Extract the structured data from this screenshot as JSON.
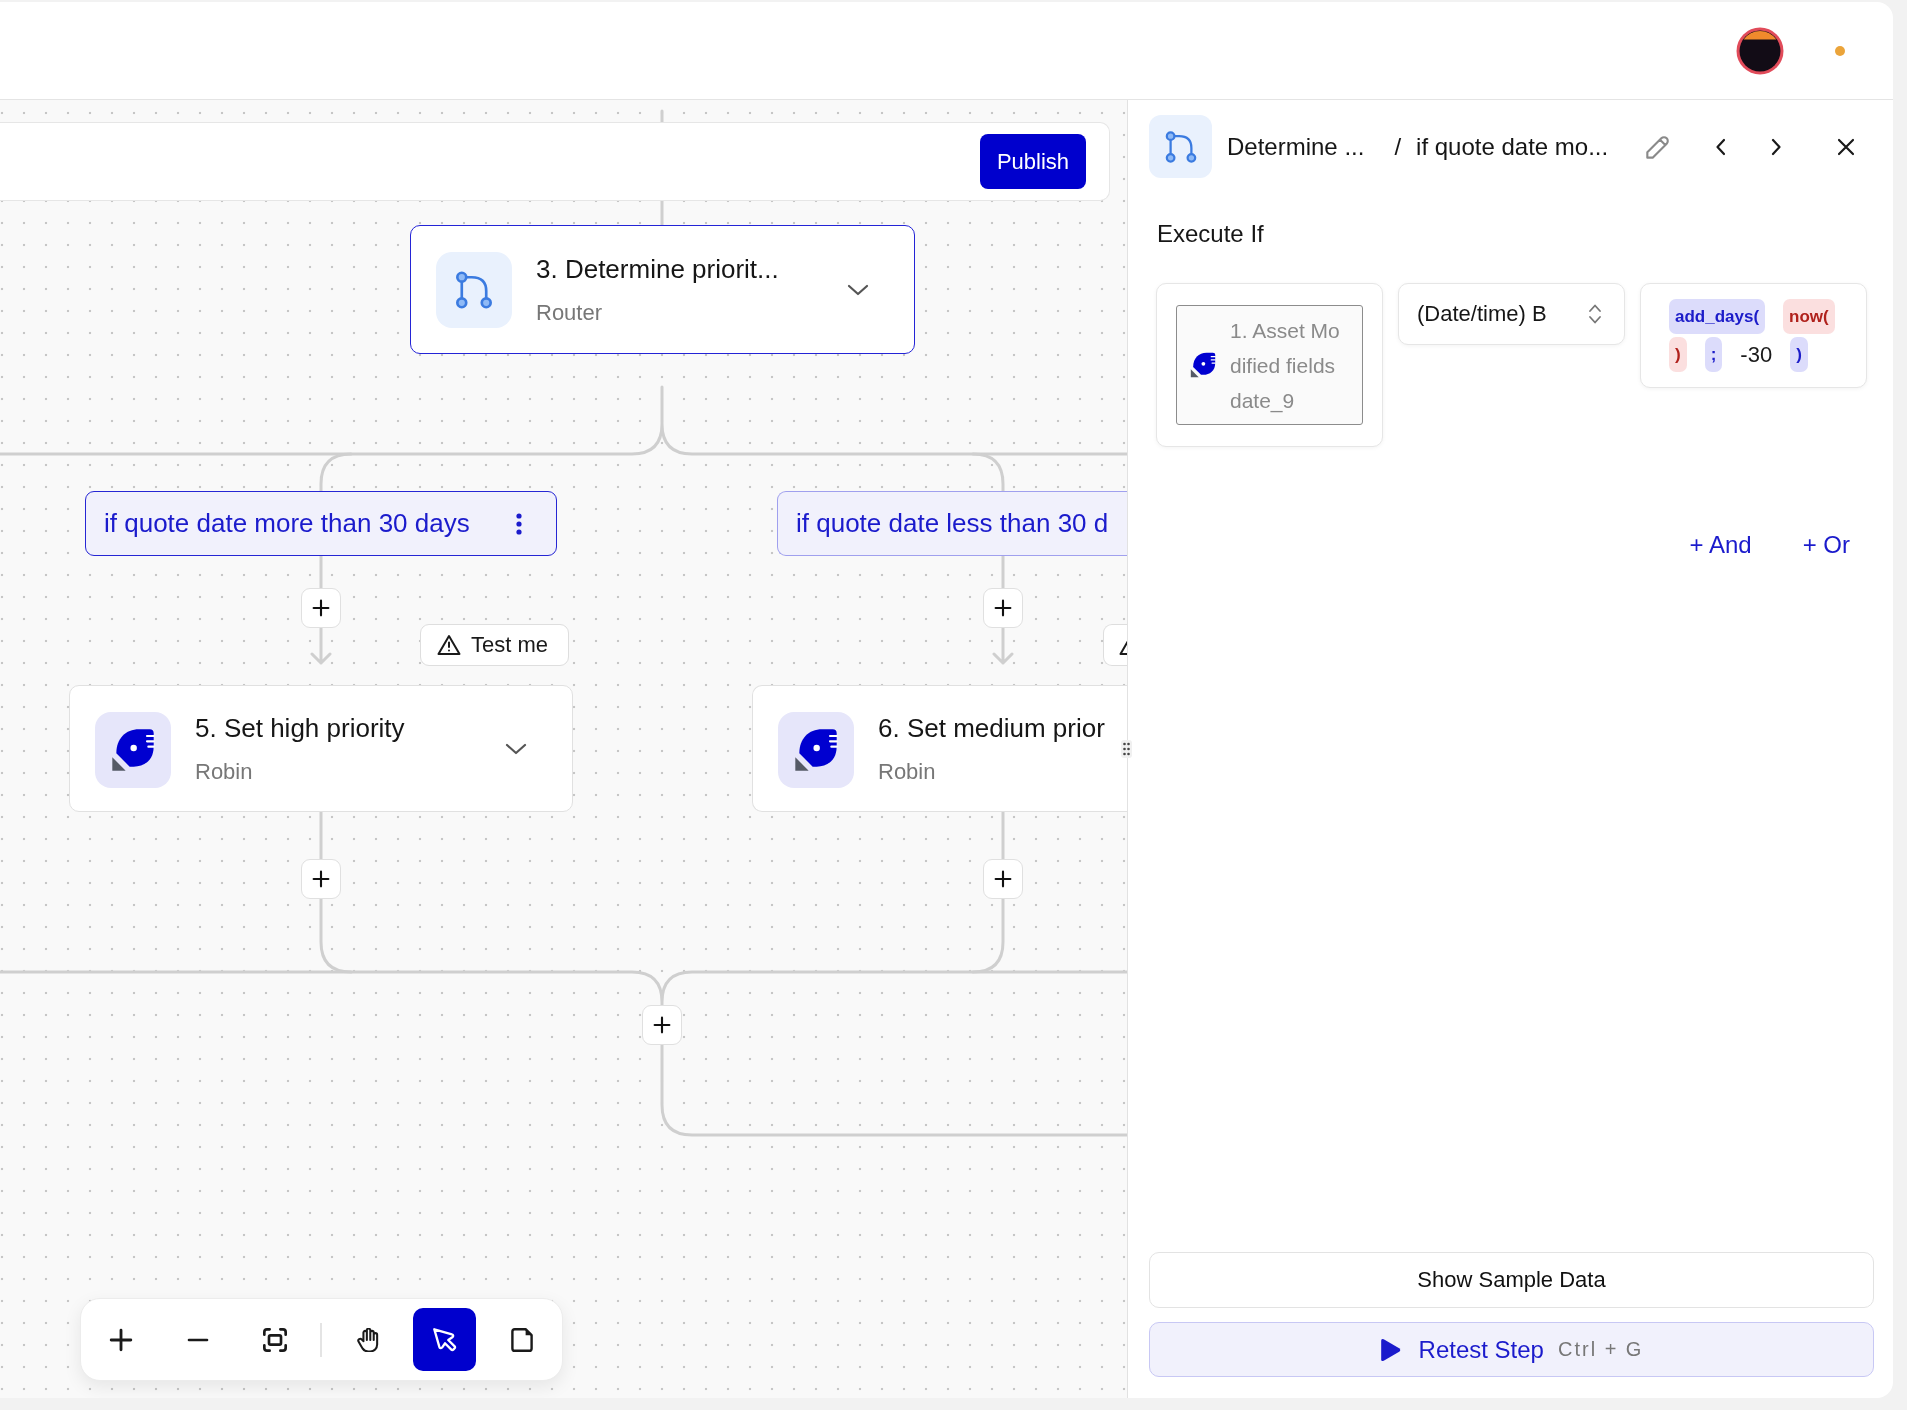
{
  "header": {
    "notification_dot": true
  },
  "canvas": {
    "toolbar": {
      "publish_button": "Publish"
    },
    "router": {
      "title": "3. Determine priorit...",
      "type": "Router",
      "selected": true
    },
    "branches": [
      {
        "label": "if quote date more than 30 days",
        "selected": true,
        "warning": true,
        "test_label": "Test me",
        "step": {
          "title": "5. Set high priority",
          "app": "Robin",
          "selected": false
        }
      },
      {
        "label": "if quote date less than 30 d",
        "selected": false,
        "warning": true,
        "step": {
          "title": "6. Set medium prior",
          "app": "Robin",
          "selected": false
        }
      }
    ],
    "tool_groups": [
      {
        "tools": [
          {
            "kind": "zoom-in",
            "selected": false
          },
          {
            "kind": "zoom-out",
            "selected": false
          },
          {
            "kind": "fit",
            "selected": false
          }
        ]
      },
      {
        "tools": [
          {
            "kind": "hand",
            "selected": false
          },
          {
            "kind": "pointer",
            "selected": true
          },
          {
            "kind": "note",
            "selected": false
          }
        ]
      }
    ]
  },
  "panel": {
    "breadcrumb": {
      "parent": "Determine ...",
      "separator": "/",
      "current": "if quote date mo..."
    },
    "section_title": "Execute If",
    "condition": {
      "field": "1. Asset Modified fields date_9",
      "operator": "(Date/time) B",
      "value_tokens": [
        {
          "text": "add_days(",
          "kind": "outer"
        },
        {
          "text": "now(",
          "kind": "inner"
        },
        {
          "text": ")",
          "kind": "inner"
        },
        {
          "text": ";",
          "kind": "outer"
        },
        {
          "text": "-30",
          "kind": "literal"
        },
        {
          "text": ")",
          "kind": "outer"
        }
      ]
    },
    "add_and": "+ And",
    "add_or": "+ Or",
    "sample_button": "Show Sample Data",
    "retest_button": {
      "label": "Retest Step",
      "shortcut": "Ctrl + G"
    }
  }
}
